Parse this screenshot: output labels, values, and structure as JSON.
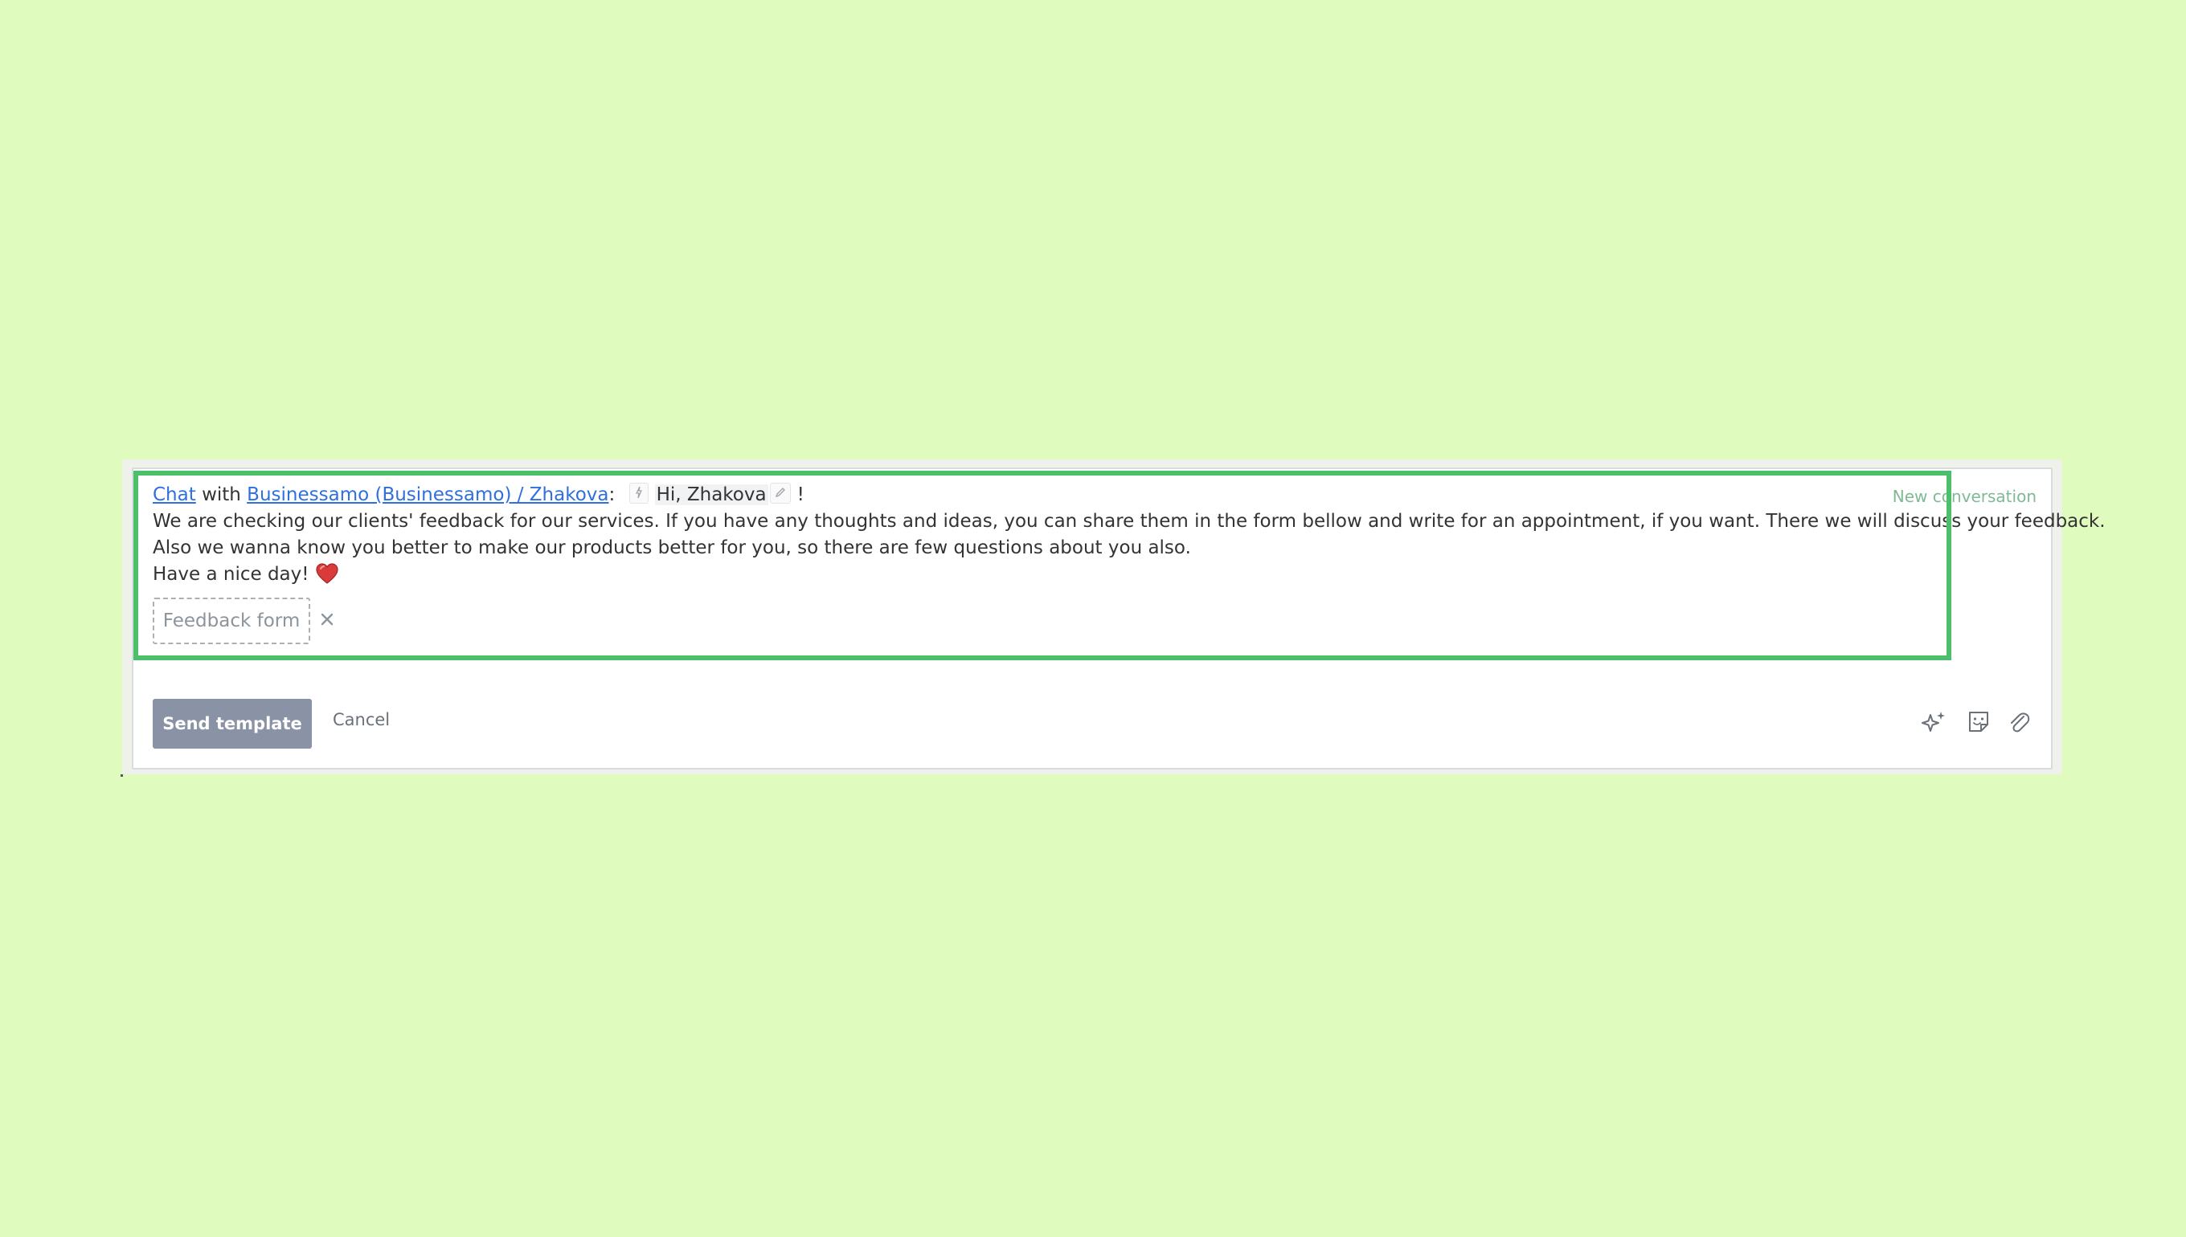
{
  "header": {
    "chat_link": "Chat",
    "with_text": "with",
    "contact_link": "Businessamo (Businessamo) / Zhakova",
    "colon": ":",
    "greeting": "Hi, Zhakova",
    "exclamation": "!",
    "new_conversation": "New conversation"
  },
  "message": {
    "line1": "We are checking our clients' feedback for our services. If you have any thoughts and ideas, you can share them in the form bellow and write for an appointment, if you want. There we will discuss your feedback.",
    "line2": "Also we wanna know you better to make our products better for you, so there are few questions about you also.",
    "line3": "Have a nice day!",
    "emoji": "heart-icon"
  },
  "attachment": {
    "label": "Feedback form",
    "remove_icon": "close-icon"
  },
  "actions": {
    "send_label": "Send template",
    "cancel_label": "Cancel"
  },
  "toolbar": {
    "icons": [
      "sparkles-icon",
      "sticker-icon",
      "paperclip-icon"
    ]
  },
  "colors": {
    "background": "#e0fbbe",
    "highlight": "#4cbf6a",
    "link": "#2f6fe0",
    "send_button": "#8a93a5",
    "new_conversation": "#7fb995"
  }
}
